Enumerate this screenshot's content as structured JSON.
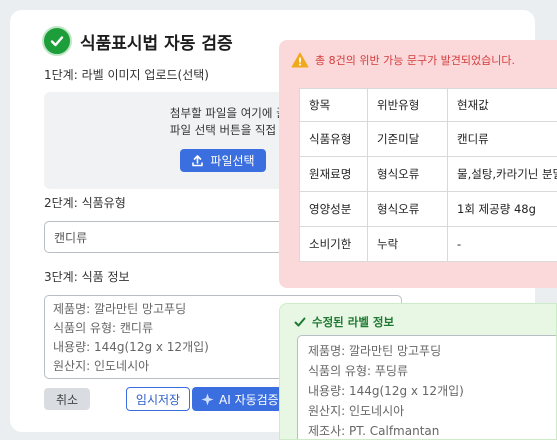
{
  "page": {
    "title": "식품표시법 자동 검증",
    "step1_label": "1단계: 라벨 이미지 업로드(선택)",
    "dropzone_line1": "첨부할 파일을 여기에 끌어다 놓",
    "dropzone_line2": "파일 선택 버튼을 직접 선택해주",
    "file_button_label": "파일선택",
    "step2_label": "2단계: 식품유형",
    "food_type_value": "캔디류",
    "step3_label": "3단계: 식품 정보",
    "food_info_lines": [
      "제품명: 깔라만틴 망고푸딩",
      "식품의 유형: 캔디류",
      "내용량: 144g(12g x 12개입)",
      "원산지: 인도네시아"
    ],
    "buttons": {
      "cancel": "취소",
      "save": "임시저장",
      "ai_verify": "AI 자동검증"
    }
  },
  "warning": {
    "message": "총 8건의 위반 가능 문구가 발견되었습니다.",
    "headers": [
      "항목",
      "위반유형",
      "현재값"
    ],
    "rows": [
      [
        "식품유형",
        "기준미달",
        "캔디류"
      ],
      [
        "원재료명",
        "형식오류",
        "물,설탕,카라기닌 분말"
      ],
      [
        "영양성분",
        "형식오류",
        "1회 제공량 48g"
      ],
      [
        "소비기한",
        "누락",
        "-"
      ]
    ]
  },
  "fixed": {
    "title": "수정된 라벨 정보",
    "lines": [
      "제품명: 깔라만틴 망고푸딩",
      "식품의 유형: 푸딩류",
      "내용량: 144g(12g x 12개입)",
      "원산지: 인도네시아",
      "제조사: PT. Calfmantan"
    ]
  },
  "colors": {
    "accent": "#3b6fe0",
    "success": "#1e9e3a",
    "danger": "#d33c3c",
    "warning_bg": "#fbd9da",
    "success_bg": "#e8f7e4"
  },
  "icons": [
    "check-circle-icon",
    "upload-icon",
    "sparkle-icon",
    "warning-triangle-icon",
    "check-icon"
  ]
}
